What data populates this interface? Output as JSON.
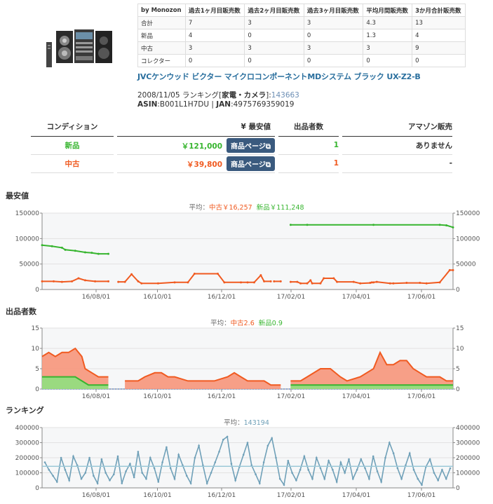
{
  "sales_table": {
    "headers": [
      "by Monozon",
      "過去1ヶ月目販売数",
      "過去2ヶ月目販売数",
      "過去3ヶ月目販売数",
      "平均月間販売数",
      "3か月合計販売数"
    ],
    "rows": [
      [
        "合計",
        "7",
        "3",
        "3",
        "4.3",
        "13"
      ],
      [
        "新品",
        "4",
        "0",
        "0",
        "1.3",
        "4"
      ],
      [
        "中古",
        "3",
        "3",
        "3",
        "3",
        "9"
      ],
      [
        "コレクター",
        "0",
        "0",
        "0",
        "0",
        "0"
      ]
    ]
  },
  "product": {
    "title": "JVCケンウッド ビクター マイクロコンポーネントMDシステム ブラック UX-Z2-B",
    "rank_prefix": "2008/11/05 ランキング[",
    "rank_category": "家電・カメラ",
    "rank_mid": "]:",
    "rank_value": "143663",
    "asin_label": "ASIN",
    "asin": ":B001L1H7DU | ",
    "jan_label": "JAN",
    "jan": ":4975769359019"
  },
  "condition_table": {
    "headers": {
      "condition": "コンディション",
      "price": "¥ 最安値",
      "sellers": "出品者数",
      "amazon": "アマゾン販売"
    },
    "rows": [
      {
        "condition": "新品",
        "price": "￥121,000",
        "button": "商品ページ",
        "sellers": "1",
        "amazon": "ありません"
      },
      {
        "condition": "中古",
        "price": "￥39,800",
        "button": "商品ページ",
        "sellers": "1",
        "amazon": "-"
      }
    ]
  },
  "colors": {
    "used": "#f05a20",
    "new": "#37b52f",
    "rank": "#6fa0b8",
    "used_fill": "#f7957a",
    "new_fill": "#8fe07f"
  },
  "charts": {
    "price": {
      "label": "最安値",
      "avg_prefix": "平均：",
      "avg_used": "中古￥16,257",
      "avg_new": "新品￥111,248"
    },
    "sellers": {
      "label": "出品者数",
      "avg_prefix": "平均：",
      "avg_used": "中古2.6",
      "avg_new": "新品0.9"
    },
    "ranking": {
      "label": "ランキング",
      "avg_prefix": "平均：",
      "avg_value": "143194"
    }
  },
  "chart_data": [
    {
      "type": "line",
      "title": "最安値",
      "x_ticks": [
        "16/08/01",
        "16/10/01",
        "16/12/01",
        "17/02/01",
        "17/04/01",
        "17/06/01"
      ],
      "ylim": [
        0,
        150000
      ],
      "y_ticks": [
        "0",
        "50000",
        "100000",
        "150000"
      ],
      "grid": true,
      "series": [
        {
          "name": "中古",
          "segments": [
            [
              [
                0,
                16000
              ],
              [
                0.035,
                16000
              ],
              [
                0.06,
                15000
              ],
              [
                0.09,
                16000
              ],
              [
                0.11,
                22000
              ],
              [
                0.13,
                18000
              ],
              [
                0.16,
                16000
              ],
              [
                0.2,
                16000
              ]
            ],
            [
              [
                0.23,
                15000
              ],
              [
                0.25,
                15000
              ],
              [
                0.27,
                30000
              ],
              [
                0.29,
                16000
              ],
              [
                0.3,
                12000
              ],
              [
                0.35,
                12000
              ],
              [
                0.4,
                14000
              ],
              [
                0.44,
                14000
              ],
              [
                0.46,
                31000
              ],
              [
                0.53,
                31000
              ],
              [
                0.55,
                14000
              ],
              [
                0.6,
                14000
              ],
              [
                0.62,
                14000
              ],
              [
                0.64,
                14000
              ],
              [
                0.66,
                28000
              ],
              [
                0.67,
                16000
              ],
              [
                0.69,
                16000
              ]
            ],
            [
              [
                0.7,
                16000
              ],
              [
                0.72,
                16000
              ]
            ],
            [
              [
                0.75,
                15000
              ],
              [
                0.77,
                15000
              ],
              [
                0.78,
                12000
              ],
              [
                0.8,
                12000
              ],
              [
                0.81,
                18000
              ],
              [
                0.815,
                12000
              ],
              [
                0.84,
                12000
              ],
              [
                0.85,
                22000
              ],
              [
                0.88,
                22000
              ],
              [
                0.89,
                15000
              ],
              [
                0.94,
                15000
              ],
              [
                0.96,
                12000
              ],
              [
                0.99,
                13000
              ],
              [
                0.995,
                14000
              ]
            ],
            [
              [
                1.0,
                14000
              ],
              [
                1.01,
                15000
              ],
              [
                1.05,
                12000
              ],
              [
                1.06,
                12000
              ],
              [
                1.1,
                13000
              ],
              [
                1.14,
                13000
              ],
              [
                1.16,
                12000
              ],
              [
                1.2,
                14000
              ],
              [
                1.23,
                38000
              ],
              [
                1.24,
                38000
              ]
            ]
          ]
        },
        {
          "name": "新品",
          "segments": [
            [
              [
                0,
                87000
              ],
              [
                0.03,
                85000
              ],
              [
                0.06,
                82000
              ],
              [
                0.07,
                78000
              ],
              [
                0.1,
                76000
              ],
              [
                0.13,
                73000
              ],
              [
                0.15,
                72000
              ],
              [
                0.17,
                70000
              ],
              [
                0.2,
                70000
              ]
            ],
            [
              [
                0.75,
                127000
              ],
              [
                0.8,
                127000
              ],
              [
                1.0,
                127000
              ],
              [
                1.2,
                127000
              ],
              [
                1.22,
                126000
              ],
              [
                1.24,
                122000
              ]
            ]
          ]
        }
      ]
    },
    {
      "type": "area",
      "title": "出品者数",
      "x_ticks": [
        "16/08/01",
        "16/10/01",
        "16/12/01",
        "17/02/01",
        "17/04/01",
        "17/06/01"
      ],
      "ylim": [
        0,
        15
      ],
      "y_ticks": [
        "0",
        "5",
        "10",
        "15"
      ],
      "grid": true,
      "series": [
        {
          "name": "中古",
          "segments": [
            [
              [
                0,
                8
              ],
              [
                0.02,
                9
              ],
              [
                0.04,
                8
              ],
              [
                0.06,
                9
              ],
              [
                0.08,
                9
              ],
              [
                0.1,
                10
              ],
              [
                0.12,
                8
              ],
              [
                0.13,
                5
              ],
              [
                0.15,
                4
              ],
              [
                0.17,
                3
              ],
              [
                0.2,
                3
              ]
            ],
            [
              [
                0.25,
                2
              ],
              [
                0.29,
                2
              ],
              [
                0.31,
                3
              ],
              [
                0.34,
                4
              ],
              [
                0.36,
                4
              ],
              [
                0.38,
                3
              ],
              [
                0.4,
                3
              ],
              [
                0.44,
                2
              ],
              [
                0.48,
                2
              ],
              [
                0.52,
                2
              ],
              [
                0.56,
                3
              ],
              [
                0.58,
                4
              ],
              [
                0.6,
                3
              ],
              [
                0.62,
                2
              ],
              [
                0.65,
                2
              ],
              [
                0.67,
                2
              ],
              [
                0.69,
                1
              ],
              [
                0.72,
                1
              ]
            ],
            [
              [
                0.75,
                2
              ],
              [
                0.78,
                2
              ],
              [
                0.8,
                3
              ],
              [
                0.84,
                5
              ],
              [
                0.87,
                5
              ],
              [
                0.9,
                3
              ],
              [
                0.92,
                2
              ],
              [
                0.96,
                3
              ],
              [
                1.0,
                5
              ],
              [
                1.02,
                9
              ],
              [
                1.04,
                6
              ],
              [
                1.06,
                6
              ],
              [
                1.08,
                7
              ],
              [
                1.1,
                7
              ],
              [
                1.12,
                5
              ],
              [
                1.14,
                4
              ],
              [
                1.16,
                3
              ],
              [
                1.2,
                3
              ],
              [
                1.22,
                2
              ],
              [
                1.24,
                2
              ]
            ]
          ]
        },
        {
          "name": "新品",
          "segments": [
            [
              [
                0,
                3
              ],
              [
                0.1,
                3
              ],
              [
                0.12,
                2
              ],
              [
                0.14,
                1
              ],
              [
                0.2,
                1
              ]
            ],
            [
              [
                0.75,
                1
              ],
              [
                1.24,
                1
              ]
            ]
          ]
        }
      ]
    },
    {
      "type": "line",
      "title": "ランキング",
      "x_ticks": [
        "16/08/01",
        "16/10/01",
        "16/12/01",
        "17/02/01",
        "17/04/01",
        "17/06/01"
      ],
      "ylim": [
        0,
        400000
      ],
      "y_ticks": [
        "0",
        "100000",
        "200000",
        "300000",
        "400000"
      ],
      "grid": true,
      "average": 143194,
      "series": [
        {
          "name": "ランキング",
          "values": [
            170000,
            120000,
            80000,
            40000,
            200000,
            120000,
            50000,
            210000,
            150000,
            60000,
            100000,
            200000,
            80000,
            30000,
            190000,
            100000,
            50000,
            90000,
            210000,
            30000,
            110000,
            160000,
            70000,
            240000,
            100000,
            60000,
            200000,
            130000,
            40000,
            170000,
            270000,
            130000,
            60000,
            220000,
            150000,
            80000,
            30000,
            200000,
            280000,
            150000,
            30000,
            100000,
            170000,
            240000,
            320000,
            340000,
            160000,
            50000,
            140000,
            220000,
            300000,
            150000,
            90000,
            30000,
            170000,
            280000,
            330000,
            200000,
            60000,
            20000,
            180000,
            100000,
            50000,
            120000,
            210000,
            120000,
            60000,
            200000,
            130000,
            60000,
            180000,
            120000,
            40000,
            170000,
            100000,
            190000,
            60000,
            120000,
            190000,
            130000,
            60000,
            210000,
            110000,
            40000,
            200000,
            300000,
            230000,
            130000,
            60000,
            150000,
            230000,
            120000,
            60000,
            20000,
            140000,
            190000,
            100000,
            50000,
            120000,
            60000,
            130000
          ]
        }
      ]
    }
  ]
}
